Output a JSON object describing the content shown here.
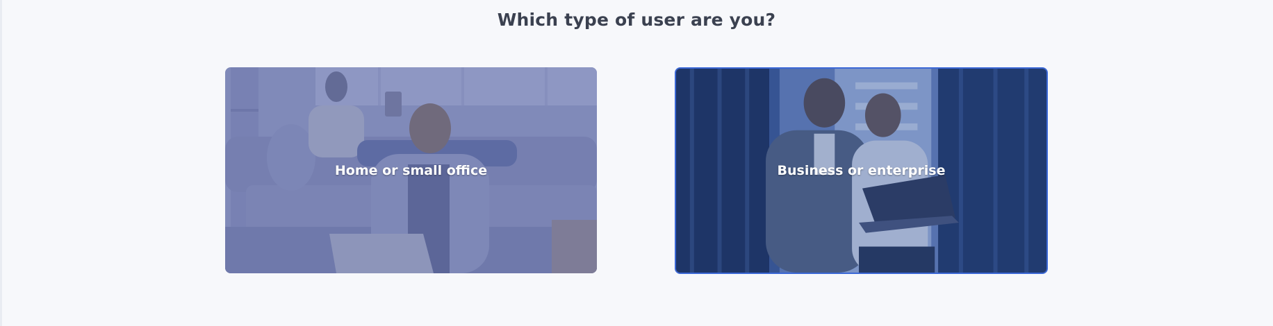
{
  "heading": "Which type of user are you?",
  "options": [
    {
      "label": "Home or small office",
      "selected": false
    },
    {
      "label": "Business or enterprise",
      "selected": true
    }
  ],
  "colors": {
    "heading": "#3b4150",
    "home_overlay": "#6f79ad",
    "business_overlay": "#2b4a8e",
    "selected_border": "#3b68d6"
  }
}
